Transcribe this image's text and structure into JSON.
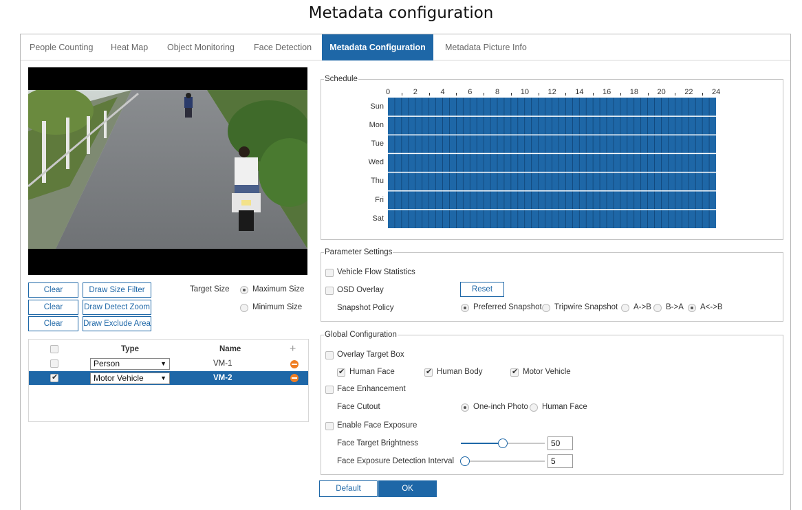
{
  "page_title": "Metadata configuration",
  "tabs": [
    {
      "label": "People Counting"
    },
    {
      "label": "Heat Map"
    },
    {
      "label": "Object Monitoring"
    },
    {
      "label": "Face Detection"
    },
    {
      "label": "Metadata Configuration",
      "active": true
    },
    {
      "label": "Metadata Picture Info"
    }
  ],
  "draw_controls": {
    "clear_label": "Clear",
    "draw_size_filter": "Draw Size Filter",
    "draw_detect_zoom": "Draw Detect Zoom",
    "draw_exclude_area": "Draw Exclude Area",
    "target_size_label": "Target Size",
    "maximum_size": "Maximum Size",
    "minimum_size": "Minimum Size",
    "selected_target_size": "Maximum Size"
  },
  "target_table": {
    "headers": {
      "type": "Type",
      "name": "Name",
      "add": "+"
    },
    "rows": [
      {
        "type": "Person",
        "name": "VM-1",
        "checked": false,
        "selected": false
      },
      {
        "type": "Motor Vehicle",
        "name": "VM-2",
        "checked": true,
        "selected": true
      }
    ]
  },
  "schedule": {
    "legend": "Schedule",
    "hours": [
      "0",
      "2",
      "4",
      "6",
      "8",
      "10",
      "12",
      "14",
      "16",
      "18",
      "20",
      "22",
      "24"
    ],
    "days": [
      "Sun",
      "Mon",
      "Tue",
      "Wed",
      "Thu",
      "Fri",
      "Sat"
    ],
    "all_selected": true,
    "fill_color": "#1e67a7"
  },
  "parameter_settings": {
    "legend": "Parameter Settings",
    "vehicle_flow_statistics": {
      "label": "Vehicle Flow Statistics",
      "checked": false
    },
    "osd_overlay": {
      "label": "OSD Overlay",
      "checked": false
    },
    "reset_label": "Reset",
    "snapshot_policy_label": "Snapshot Policy",
    "snapshot_options": [
      "Preferred Snapshot",
      "Tripwire Snapshot"
    ],
    "snapshot_selected": "Preferred Snapshot",
    "direction_options": [
      "A->B",
      "B->A",
      "A<->B"
    ],
    "direction_selected": "A<->B"
  },
  "global_configuration": {
    "legend": "Global Configuration",
    "overlay_target_box": {
      "label": "Overlay Target Box",
      "checked": false
    },
    "overlay_items": [
      {
        "label": "Human Face",
        "checked": true
      },
      {
        "label": "Human Body",
        "checked": true
      },
      {
        "label": "Motor Vehicle",
        "checked": true
      }
    ],
    "face_enhancement": {
      "label": "Face Enhancement",
      "checked": false
    },
    "face_cutout_label": "Face Cutout",
    "face_cutout_options": [
      "One-inch Photo",
      "Human Face"
    ],
    "face_cutout_selected": "One-inch Photo",
    "enable_face_exposure": {
      "label": "Enable Face Exposure",
      "checked": false
    },
    "face_target_brightness": {
      "label": "Face Target Brightness",
      "value": "50",
      "fraction": 0.5
    },
    "face_exposure_detection_interval": {
      "label": "Face Exposure Detection Interval",
      "value": "5",
      "fraction": 0.05
    }
  },
  "footer": {
    "default_label": "Default",
    "ok_label": "OK"
  },
  "colors": {
    "accent": "#1e67a7",
    "remove": "#ef7d22"
  }
}
